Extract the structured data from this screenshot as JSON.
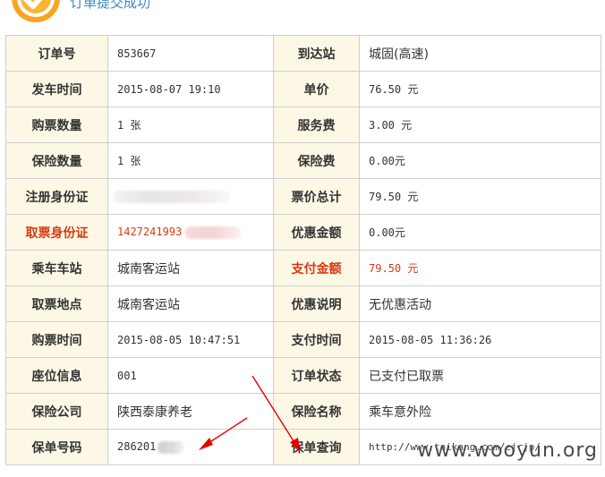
{
  "header": {
    "title": "订单提交成功",
    "icon": "check-circle-icon"
  },
  "rows": [
    {
      "l1": "订单号",
      "v1": "853667",
      "l2": "到达站",
      "v2": "城固(高速)"
    },
    {
      "l1": "发车时间",
      "v1": "2015-08-07 19:10",
      "l2": "单价",
      "v2": "76.50 元"
    },
    {
      "l1": "购票数量",
      "v1": "1 张",
      "l2": "服务费",
      "v2": "3.00 元"
    },
    {
      "l1": "保险数量",
      "v1": "1 张",
      "l2": "保险费",
      "v2": "0.00元"
    },
    {
      "l1": "注册身份证",
      "v1": "",
      "l2": "票价总计",
      "v2": "79.50 元"
    },
    {
      "l1": "取票身份证",
      "v1": "1427241993",
      "l2": "优惠金额",
      "v2": "0.00元"
    },
    {
      "l1": "乘车车站",
      "v1": "城南客运站",
      "l2": "支付金额",
      "v2": "79.50 元"
    },
    {
      "l1": "取票地点",
      "v1": "城南客运站",
      "l2": "优惠说明",
      "v2": "无优惠活动"
    },
    {
      "l1": "购票时间",
      "v1": "2015-08-05 10:47:51",
      "l2": "支付时间",
      "v2": "2015-08-05 11:36:26"
    },
    {
      "l1": "座位信息",
      "v1": "001",
      "l2": "订单状态",
      "v2": "已支付已取票"
    },
    {
      "l1": "保险公司",
      "v1": "陕西泰康养老",
      "l2": "保险名称",
      "v2": "乘车意外险"
    },
    {
      "l1": "保单号码",
      "v1": "286201",
      "l2": "保单查询",
      "v2": "http://www.taikang.com/cjrjp/"
    }
  ],
  "watermark": "www.wooyun.org",
  "colors": {
    "accent_red": "#d9380f",
    "label_bg": "#fdf8e6",
    "header_blue": "#3a86c8",
    "border": "#cfcfcf"
  }
}
